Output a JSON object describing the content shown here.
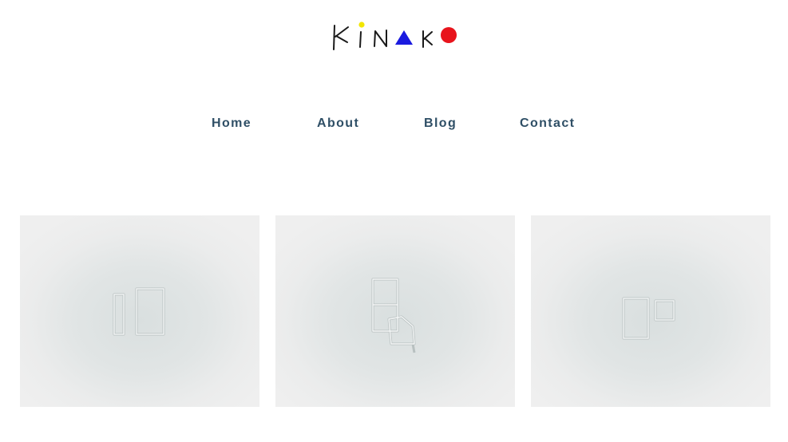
{
  "logo": {
    "text": "KINAKO",
    "dot_color": "#f2e600",
    "triangle_color": "#1a1adf",
    "circle_color": "#e8141c",
    "ink_color": "#1a1a1a"
  },
  "nav": {
    "items": [
      {
        "label": "Home"
      },
      {
        "label": "About"
      },
      {
        "label": "Blog"
      },
      {
        "label": "Contact"
      }
    ],
    "color": "#2f4f66"
  },
  "gallery": {
    "items": [
      {
        "icon": "wire-sculpture-two-rectangles"
      },
      {
        "icon": "wire-sculpture-stacked-shapes"
      },
      {
        "icon": "wire-sculpture-frame-pair"
      }
    ]
  }
}
